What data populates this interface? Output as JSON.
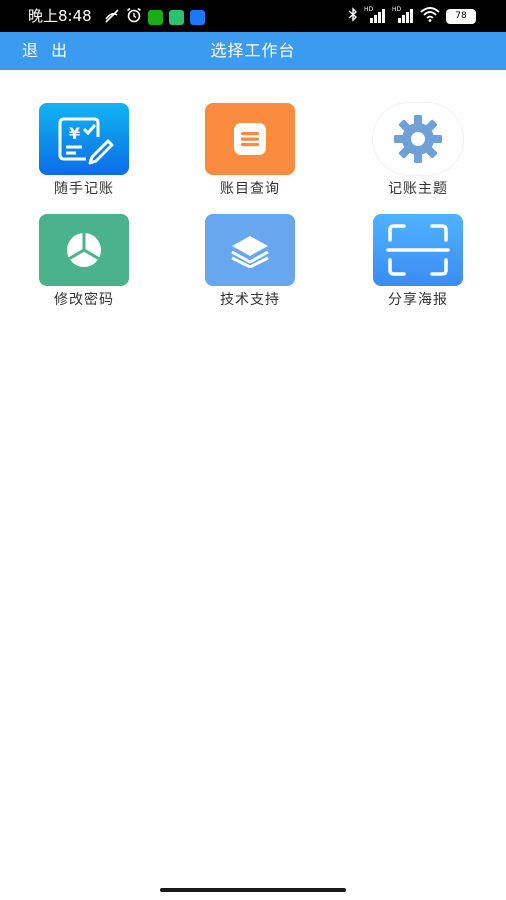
{
  "status": {
    "time": "晚上8:48",
    "battery": "78",
    "signal_label_1": "HD",
    "signal_label_2": "HD"
  },
  "header": {
    "back_label": "退 出",
    "title": "选择工作台"
  },
  "colors": {
    "header": "#3a9bf0",
    "status_bar": "#000000",
    "orange": "#fb8b3f",
    "green": "#4ab38d",
    "blue_light": "#67a7f0",
    "blue_dark": "#0a6de8",
    "gear": "#6fa0d8"
  },
  "grid": [
    {
      "label": "随手记账",
      "icon": "bookkeeping-icon"
    },
    {
      "label": "账目查询",
      "icon": "list-document-icon"
    },
    {
      "label": "记账主题",
      "icon": "gear-icon"
    },
    {
      "label": "修改密码",
      "icon": "pie-lock-icon"
    },
    {
      "label": "技术支持",
      "icon": "layers-icon"
    },
    {
      "label": "分享海报",
      "icon": "scan-icon"
    }
  ]
}
